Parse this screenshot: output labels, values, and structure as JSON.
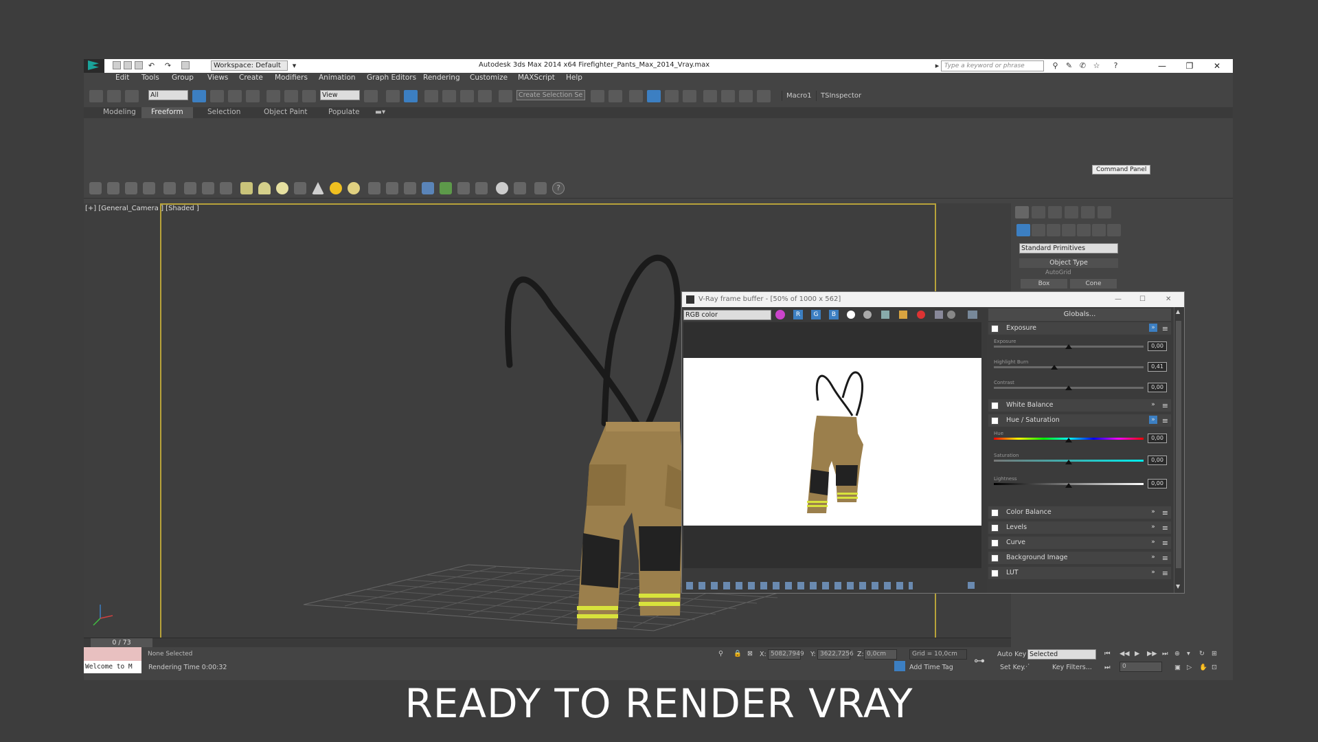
{
  "app": {
    "window_title": "Autodesk 3ds Max  2014 x64     Firefighter_Pants_Max_2014_Vray.max",
    "workspace": "Workspace: Default",
    "search_placeholder": "Type a keyword or phrase"
  },
  "menu": [
    "Edit",
    "Tools",
    "Group",
    "Views",
    "Create",
    "Modifiers",
    "Animation",
    "Graph Editors",
    "Rendering",
    "Customize",
    "MAXScript",
    "Help"
  ],
  "toolbar": {
    "selection_filter": "All",
    "reference_coord": "View",
    "named_selection": "Create Selection Se",
    "macro_buttons": [
      "Macro1",
      "TSInspector"
    ]
  },
  "ribbon_tabs": [
    "Modeling",
    "Freeform",
    "Selection",
    "Object Paint",
    "Populate"
  ],
  "viewport": {
    "label": "[+] [General_Camera ] [Shaded ]"
  },
  "command_panel": {
    "tooltip": "Command Panel",
    "category": "Standard Primitives",
    "rollout": "Object Type",
    "autogrid": "AutoGrid",
    "buttons": [
      "Box",
      "Cone"
    ]
  },
  "timeline": {
    "frame": "0 / 73"
  },
  "status": {
    "maxscript": "Welcome to M",
    "selection": "None Selected",
    "rendering_time": "Rendering Time  0:00:32",
    "x_label": "X:",
    "x_value": "5082,7949",
    "y_label": "Y:",
    "y_value": "3622,7256",
    "z_label": "Z:",
    "z_value": "0,0cm",
    "grid": "Grid = 10,0cm",
    "add_time_tag": "Add Time Tag",
    "auto_key": "Auto Key",
    "set_key": "Set Key",
    "key_mode": "Selected",
    "key_filters": "Key Filters...",
    "frame_field": "0"
  },
  "vfb": {
    "title": "V-Ray frame buffer - [50% of 1000 x 562]",
    "channel": "RGB color",
    "globals": "Globals...",
    "rows": [
      {
        "label": "Exposure",
        "expanded": true
      },
      {
        "label": "White Balance",
        "expanded": false
      },
      {
        "label": "Hue / Saturation",
        "expanded": true
      },
      {
        "label": "Color Balance",
        "expanded": false
      },
      {
        "label": "Levels",
        "expanded": false
      },
      {
        "label": "Curve",
        "expanded": false
      },
      {
        "label": "Background Image",
        "expanded": false
      },
      {
        "label": "LUT",
        "expanded": false
      }
    ],
    "exposure": [
      {
        "label": "Exposure",
        "value": "0,00",
        "pos": 0.5
      },
      {
        "label": "Highlight Burn",
        "value": "0,41",
        "pos": 0.33
      },
      {
        "label": "Contrast",
        "value": "0,00",
        "pos": 0.5
      }
    ],
    "huesat": [
      {
        "label": "Hue",
        "value": "0,00",
        "pos": 0.5
      },
      {
        "label": "Saturation",
        "value": "0,00",
        "pos": 0.5
      },
      {
        "label": "Lightness",
        "value": "0,00",
        "pos": 0.5
      }
    ]
  },
  "caption": "READY TO RENDER VRAY",
  "colors": {
    "accent": "#3c7fc2",
    "camera_frame": "#b8a33a",
    "pants": "#9b7f4c",
    "reflective": "#d8e23c"
  }
}
